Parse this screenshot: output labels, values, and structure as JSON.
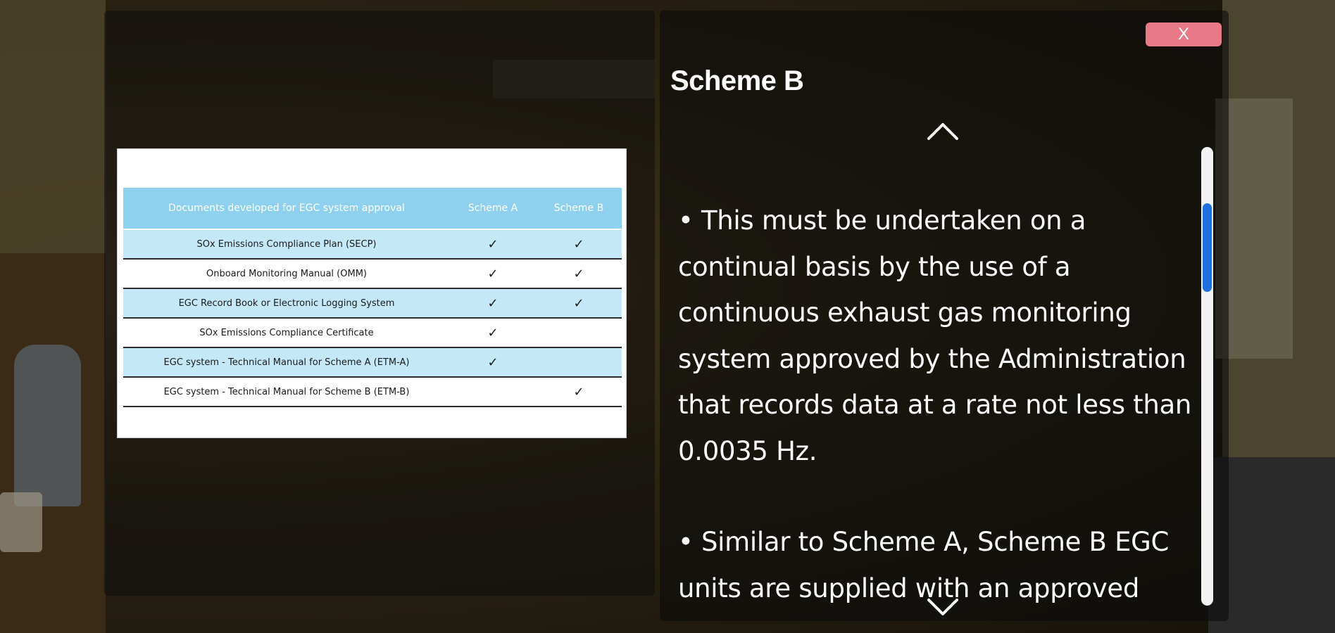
{
  "document_table": {
    "headers": [
      "Documents developed for EGC system approval",
      "Scheme A",
      "Scheme B"
    ],
    "rows": [
      {
        "name": "SOx Emissions Compliance Plan (SECP)",
        "scheme_a": "✓",
        "scheme_b": "✓"
      },
      {
        "name": "Onboard Monitoring Manual (OMM)",
        "scheme_a": "✓",
        "scheme_b": "✓"
      },
      {
        "name": "EGC Record Book or Electronic Logging System",
        "scheme_a": "✓",
        "scheme_b": "✓"
      },
      {
        "name": "SOx Emissions Compliance Certificate",
        "scheme_a": "✓",
        "scheme_b": ""
      },
      {
        "name": "EGC system - Technical Manual for Scheme A (ETM-A)",
        "scheme_a": "✓",
        "scheme_b": ""
      },
      {
        "name": "EGC system - Technical Manual for Scheme B (ETM-B)",
        "scheme_a": "",
        "scheme_b": "✓"
      }
    ]
  },
  "panel": {
    "close_label": "X",
    "title": "Scheme B",
    "paragraphs": [
      "• This must be undertaken on a continual basis by the use of a continuous exhaust gas monitoring system approved by the Administration that records data at a rate not less than 0.0035 Hz.",
      "• Similar to Scheme A, Scheme B EGC units are supplied with an approved"
    ],
    "scroll_position": 0.15
  },
  "icons": {
    "scroll_up": "chevron-up-icon",
    "scroll_down": "chevron-down-icon"
  },
  "colors": {
    "close_button": "#e87a87",
    "table_header": "#8fd0ee",
    "table_shaded_row": "#c5e8f8",
    "scroll_thumb": "#1f6fe0"
  }
}
